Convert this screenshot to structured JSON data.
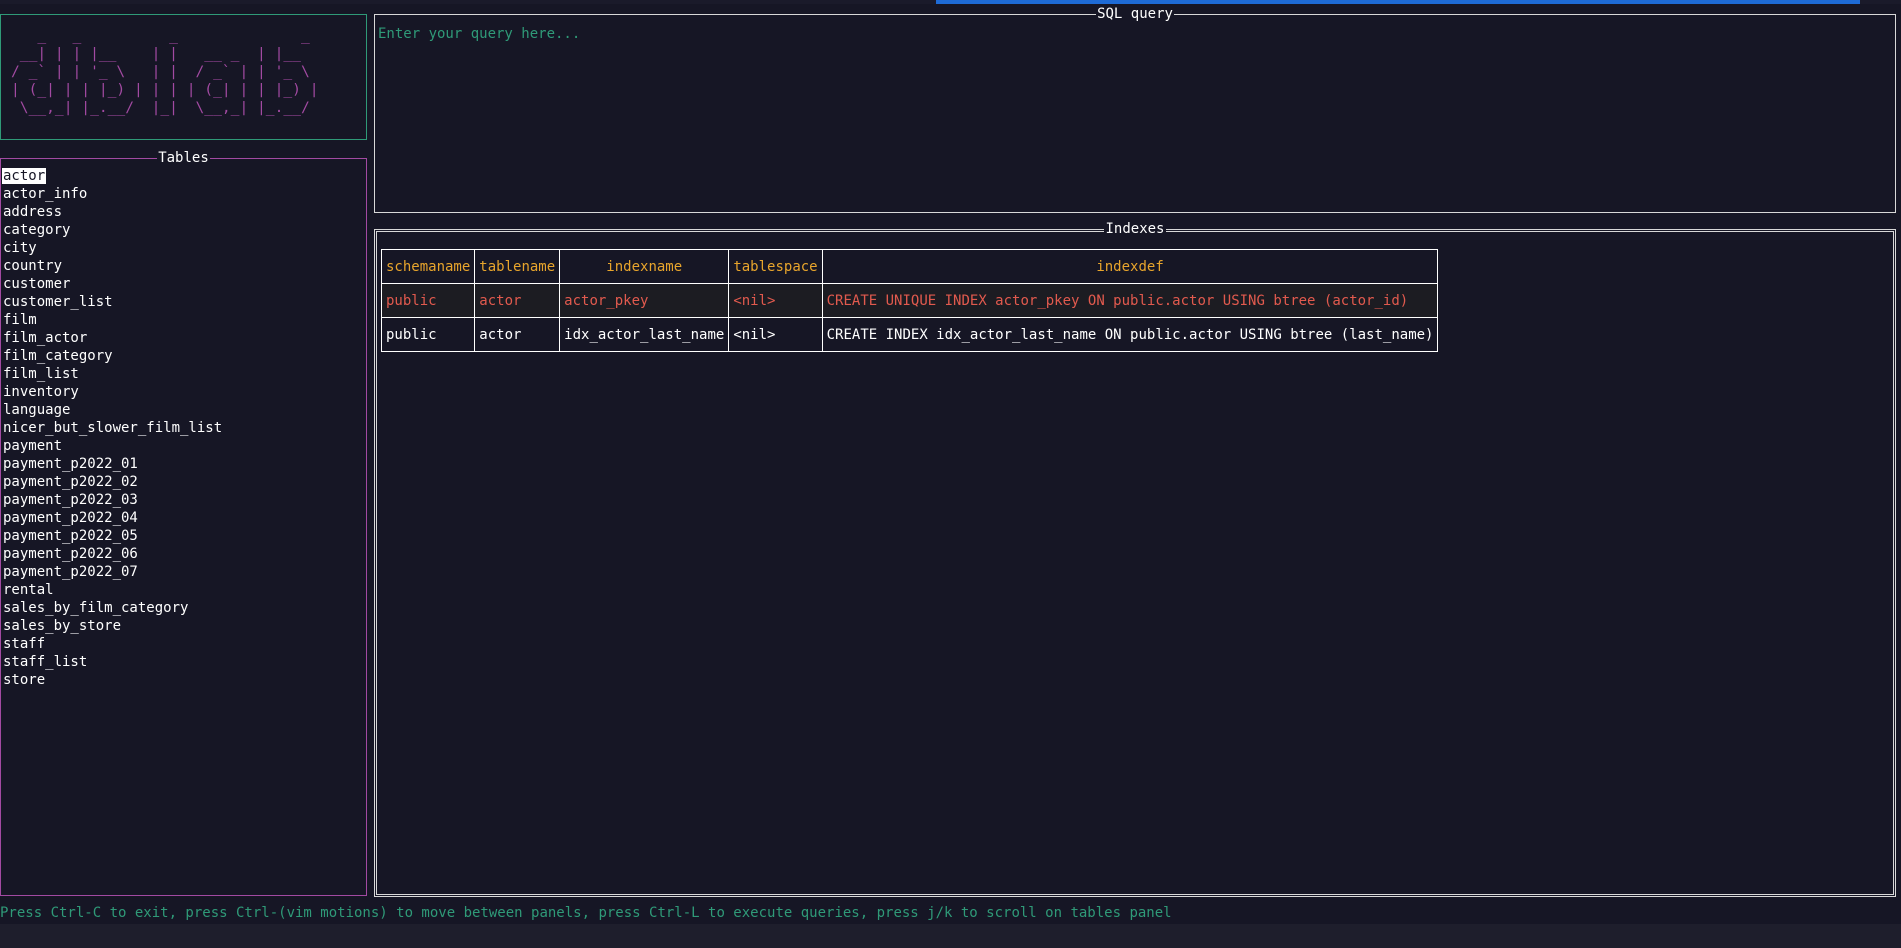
{
  "logo": {
    "ascii": "   _   _          _              _\n __| | | |__    | |   __ _  | |__\n/ _` | | '_ \\   | |  / _` | | '_ \\\n| (_| | | |_) | | | | (_| | | |_) |\n \\__,_| |_.__/  |_|  \\__,_| |_.__/"
  },
  "tables_panel": {
    "title": "Tables",
    "items": [
      "actor",
      "actor_info",
      "address",
      "category",
      "city",
      "country",
      "customer",
      "customer_list",
      "film",
      "film_actor",
      "film_category",
      "film_list",
      "inventory",
      "language",
      "nicer_but_slower_film_list",
      "payment",
      "payment_p2022_01",
      "payment_p2022_02",
      "payment_p2022_03",
      "payment_p2022_04",
      "payment_p2022_05",
      "payment_p2022_06",
      "payment_p2022_07",
      "rental",
      "sales_by_film_category",
      "sales_by_store",
      "staff",
      "staff_list",
      "store"
    ],
    "selected_index": 0
  },
  "query_panel": {
    "title": "SQL query",
    "placeholder": "Enter your query here...",
    "value": ""
  },
  "results_panel": {
    "title": "Indexes",
    "columns": [
      "schemaname",
      "tablename",
      "indexname",
      "tablespace",
      "indexdef"
    ],
    "rows": [
      [
        "public",
        "actor",
        "actor_pkey",
        "<nil>",
        "CREATE UNIQUE INDEX actor_pkey ON public.actor USING btree (actor_id)"
      ],
      [
        "public",
        "actor",
        "idx_actor_last_name",
        "<nil>",
        "CREATE INDEX idx_actor_last_name ON public.actor USING btree (last_name)"
      ]
    ],
    "selected_row": 0
  },
  "status_bar": {
    "text": "Press Ctrl-C to exit, press Ctrl-(vim motions) to move between panels, press Ctrl-L to execute queries, press j/k to scroll on tables panel"
  },
  "colors": {
    "background": "#161625",
    "logo_border": "#2f9a78",
    "tables_border": "#a24aa2",
    "logo_art": "#a24aa2",
    "header_text": "#e8a52c",
    "selected_row_text": "#e25a4e",
    "status_text": "#2f9a78",
    "accent_bar": "#1e6bd6"
  }
}
